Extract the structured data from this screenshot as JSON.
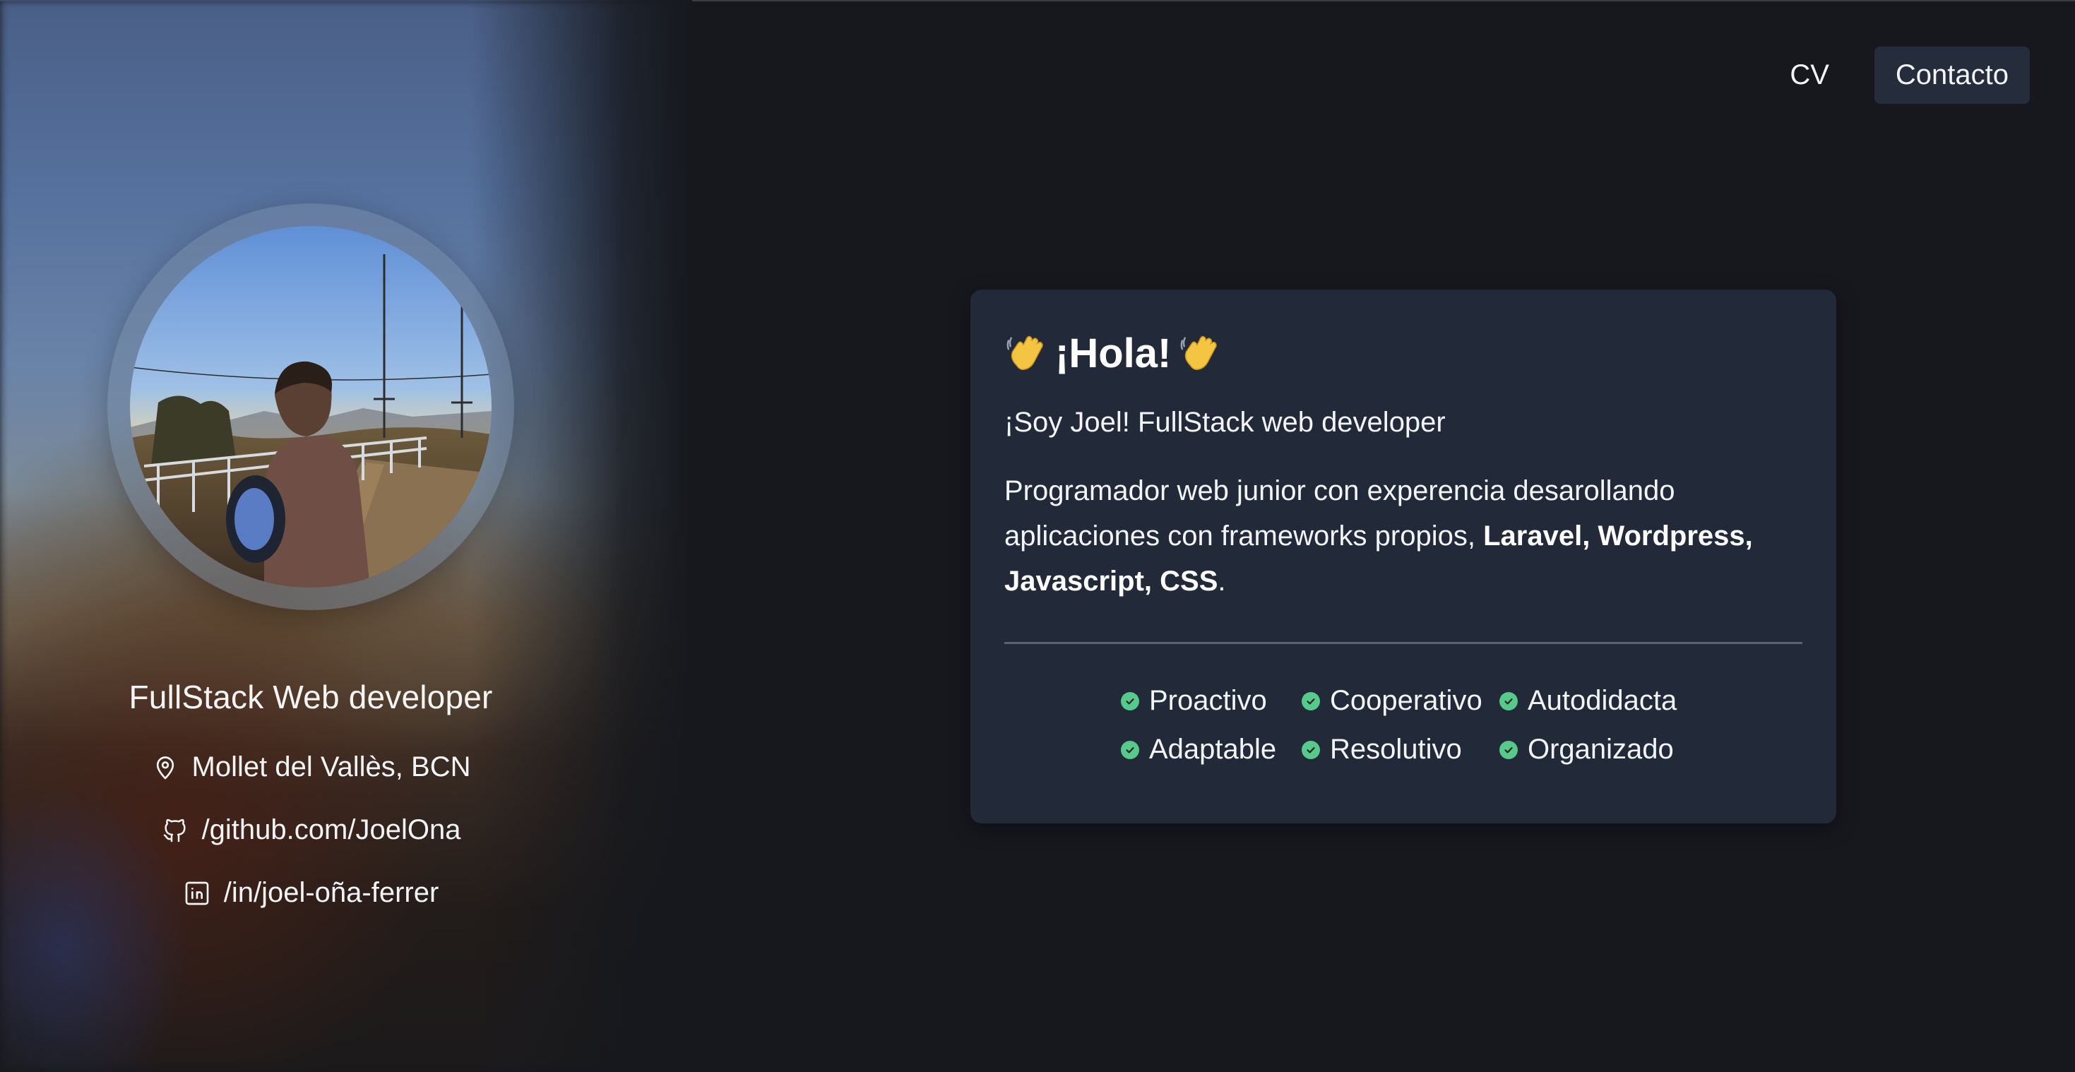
{
  "nav": {
    "items": [
      {
        "label": "CV"
      },
      {
        "label": "Contacto"
      }
    ]
  },
  "profile": {
    "avatar_icon": "portrait-photo",
    "title": "FullStack Web developer",
    "location": "Mollet del Vallès, BCN",
    "github": "/github.com/JoelOna",
    "linkedin": "/in/joel-oña-ferrer"
  },
  "card": {
    "title": "¡Hola!",
    "title_emoji_icon": "waving-hand-icon",
    "subtitle": "¡Soy Joel! FullStack web developer",
    "body_prefix": "Programador web junior con experencia desarollando aplicaciones con frameworks propios, ",
    "body_bold": "Laravel, Wordpress, Javascript, CSS",
    "body_suffix": ".",
    "traits": [
      {
        "label": "Proactivo"
      },
      {
        "label": "Cooperativo"
      },
      {
        "label": "Autodidacta"
      },
      {
        "label": "Adaptable"
      },
      {
        "label": "Resolutivo"
      },
      {
        "label": "Organizado"
      }
    ]
  },
  "colors": {
    "background": "#16181d",
    "card": "#222938",
    "active_nav": "#252c3b",
    "check": "#57c98a"
  }
}
